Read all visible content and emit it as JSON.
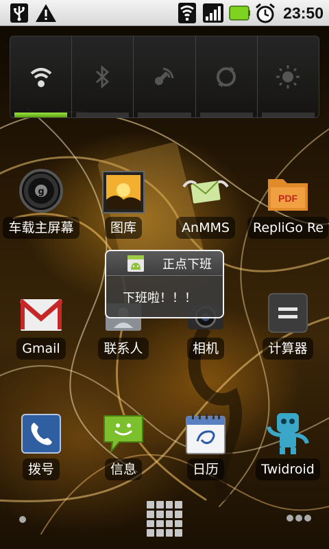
{
  "status_bar": {
    "icons": [
      "usb-icon",
      "warning-icon",
      "wifi-icon",
      "signal-icon",
      "battery-icon",
      "alarm-icon"
    ],
    "time": "23:50"
  },
  "power_widget": {
    "toggles": [
      {
        "name": "wifi",
        "icon": "wifi-icon",
        "on": true
      },
      {
        "name": "bluetooth",
        "icon": "bluetooth-icon",
        "on": false
      },
      {
        "name": "gps",
        "icon": "gps-icon",
        "on": false
      },
      {
        "name": "sync",
        "icon": "sync-icon",
        "on": false
      },
      {
        "name": "brightness",
        "icon": "brightness-icon",
        "on": false
      }
    ]
  },
  "apps": [
    {
      "label": "车载主屏幕",
      "icon": "car-home-icon"
    },
    {
      "label": "图库",
      "icon": "gallery-icon"
    },
    {
      "label": "AnMMS",
      "icon": "mms-envelope-icon"
    },
    {
      "label": "RepliGo Re",
      "icon": "pdf-reader-icon"
    },
    {
      "label": "Gmail",
      "icon": "gmail-icon"
    },
    {
      "label": "联系人",
      "icon": "contacts-icon"
    },
    {
      "label": "相机",
      "icon": "camera-icon"
    },
    {
      "label": "计算器",
      "icon": "calculator-icon"
    },
    {
      "label": "拨号",
      "icon": "phone-icon"
    },
    {
      "label": "信息",
      "icon": "messaging-icon"
    },
    {
      "label": "日历",
      "icon": "calendar-icon"
    },
    {
      "label": "Twidroid",
      "icon": "twidroid-robot-icon"
    }
  ],
  "toast": {
    "icon": "android-app-icon",
    "title": "正点下班",
    "message": "下班啦！！！"
  },
  "dock": {
    "left": "page-indicator-dot",
    "center": "app-drawer-icon",
    "right": "more-pages-icon"
  }
}
